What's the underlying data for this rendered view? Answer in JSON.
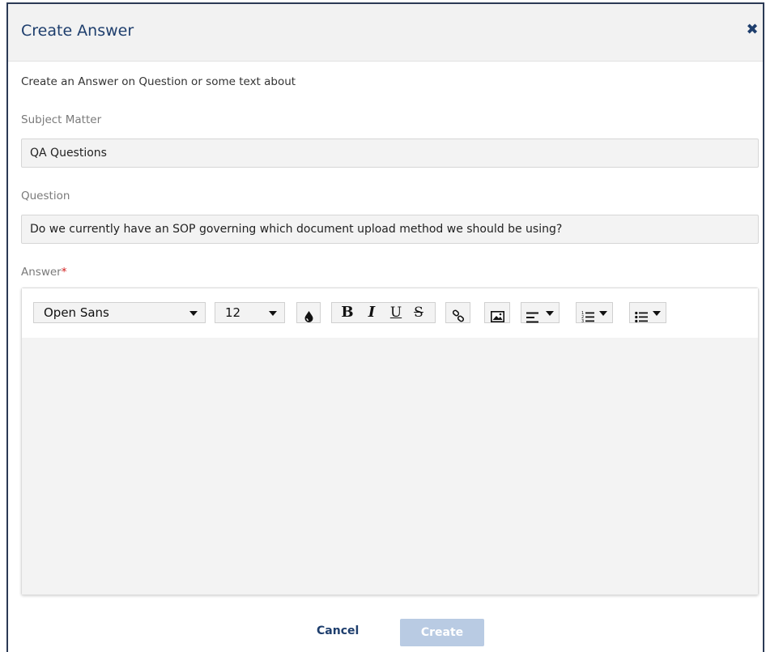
{
  "dialog": {
    "title": "Create Answer",
    "close_glyph": "✖"
  },
  "intro_text": "Create an Answer on Question or some text about",
  "fields": {
    "subject": {
      "label": "Subject Matter",
      "value": "QA Questions"
    },
    "question": {
      "label": "Question",
      "value": "Do we currently have an SOP governing which document upload method we should be using?"
    },
    "answer": {
      "label": "Answer",
      "required_mark": "*",
      "value": ""
    }
  },
  "toolbar": {
    "font_family": "Open Sans",
    "font_size": "12",
    "color_icon": "drop-icon",
    "bold": "B",
    "italic": "I",
    "underline": "U",
    "strike": "S",
    "link_icon": "link-icon",
    "image_icon": "image-icon",
    "align_icon": "align-left-icon",
    "ordered_list_icon": "ordered-list-icon",
    "unordered_list_icon": "unordered-list-icon"
  },
  "footer": {
    "cancel": "Cancel",
    "create": "Create"
  },
  "colors": {
    "accent": "#1e3e6d",
    "create_disabled": "#b9cbe3",
    "required": "#d11a1a"
  }
}
